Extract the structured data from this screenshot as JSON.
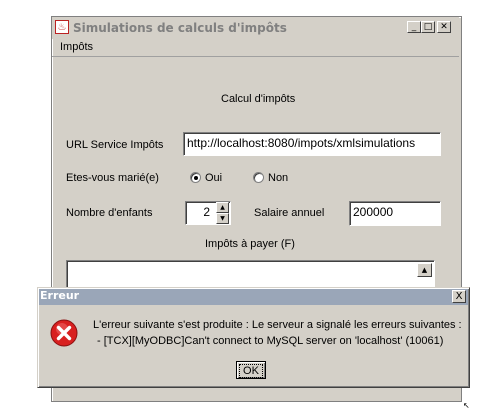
{
  "main_window": {
    "title": "Simulations de calculs d'impôts",
    "menu": [
      "Impôts"
    ],
    "form": {
      "heading": "Calcul d'impôts",
      "url_label": "URL Service Impôts",
      "url_value": "http://localhost:8080/impots/xmlsimulations",
      "married_label": "Etes-vous marié(e)",
      "married_options": [
        "Oui",
        "Non"
      ],
      "married_selected": "Oui",
      "children_label": "Nombre d'enfants",
      "children_value": "2",
      "salary_label": "Salaire annuel",
      "salary_value": "200000",
      "tax_label": "Impôts à payer (F)"
    }
  },
  "dialog": {
    "title": "Erreur",
    "close_glyph": "X",
    "message_line1": "L'erreur suivante s'est produite : Le serveur a signalé les erreurs suivantes :",
    "message_line2": "- [TCX][MyODBC]Can't connect to MySQL server on 'localhost' (10061)",
    "ok_label": "OK"
  },
  "icons": {
    "app": "java-app-icon",
    "error": "error-icon",
    "minimize": "minimize-icon",
    "maximize": "maximize-icon",
    "close": "close-icon"
  },
  "colors": {
    "window_bg": "#d4d0c8",
    "dialog_title_bg": "#9aa6b8",
    "error_red": "#d82020"
  }
}
